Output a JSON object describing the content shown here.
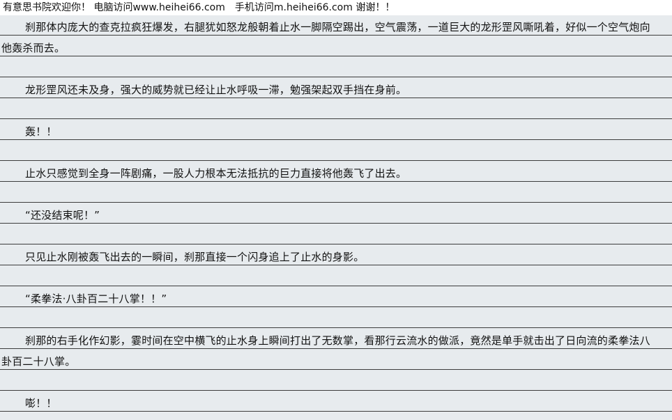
{
  "header": {
    "text": "有意思书院欢迎你！ 电脑访问www.heihei66.com　手机访问m.heihei66.com 谢谢！！"
  },
  "paragraphs": [
    "刹那体内庞大的查克拉疯狂爆发，右腿犹如怒龙般朝着止水一脚隔空踢出，空气震荡，一道巨大的龙形罡风嘶吼着，好似一个空气炮向他轰杀而去。",
    "龙形罡风还未及身，强大的威势就已经让止水呼吸一滞，勉强架起双手挡在身前。",
    "轰！！",
    "止水只感觉到全身一阵剧痛，一股人力根本无法抵抗的巨力直接将他轰飞了出去。",
    "“还没结束呢！”",
    "只见止水刚被轰飞出去的一瞬间，刹那直接一个闪身追上了止水的身影。",
    "“柔拳法·八卦百二十八掌！！”",
    "刹那的右手化作幻影，霎时间在空中横飞的止水身上瞬间打出了无数掌，看那行云流水的做派，竟然是单手就击出了日向流的柔拳法八卦百二十八掌。",
    "嘭！！"
  ]
}
